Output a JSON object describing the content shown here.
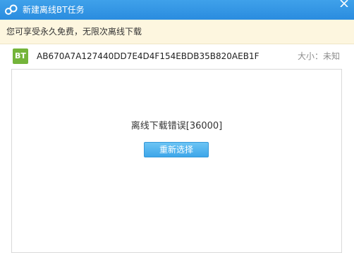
{
  "window": {
    "title": "新建离线BT任务"
  },
  "notice": {
    "text": "您可享受永久免费，无限次离线下载"
  },
  "file": {
    "badge": "BT",
    "hash": "AB670A7A127440DD7E4D4F154EBDB35B820AEB1F",
    "size": "大小：未知"
  },
  "content": {
    "error": "离线下载错误[36000]",
    "reselect_label": "重新选择"
  },
  "colors": {
    "titlebar": "#2e92e4",
    "notice_bg": "#fdf6df",
    "badge_green": "#74b43a",
    "button_blue": "#4aaeed"
  },
  "icons": {
    "app": "cloud-link-icon",
    "close": "close-icon"
  }
}
